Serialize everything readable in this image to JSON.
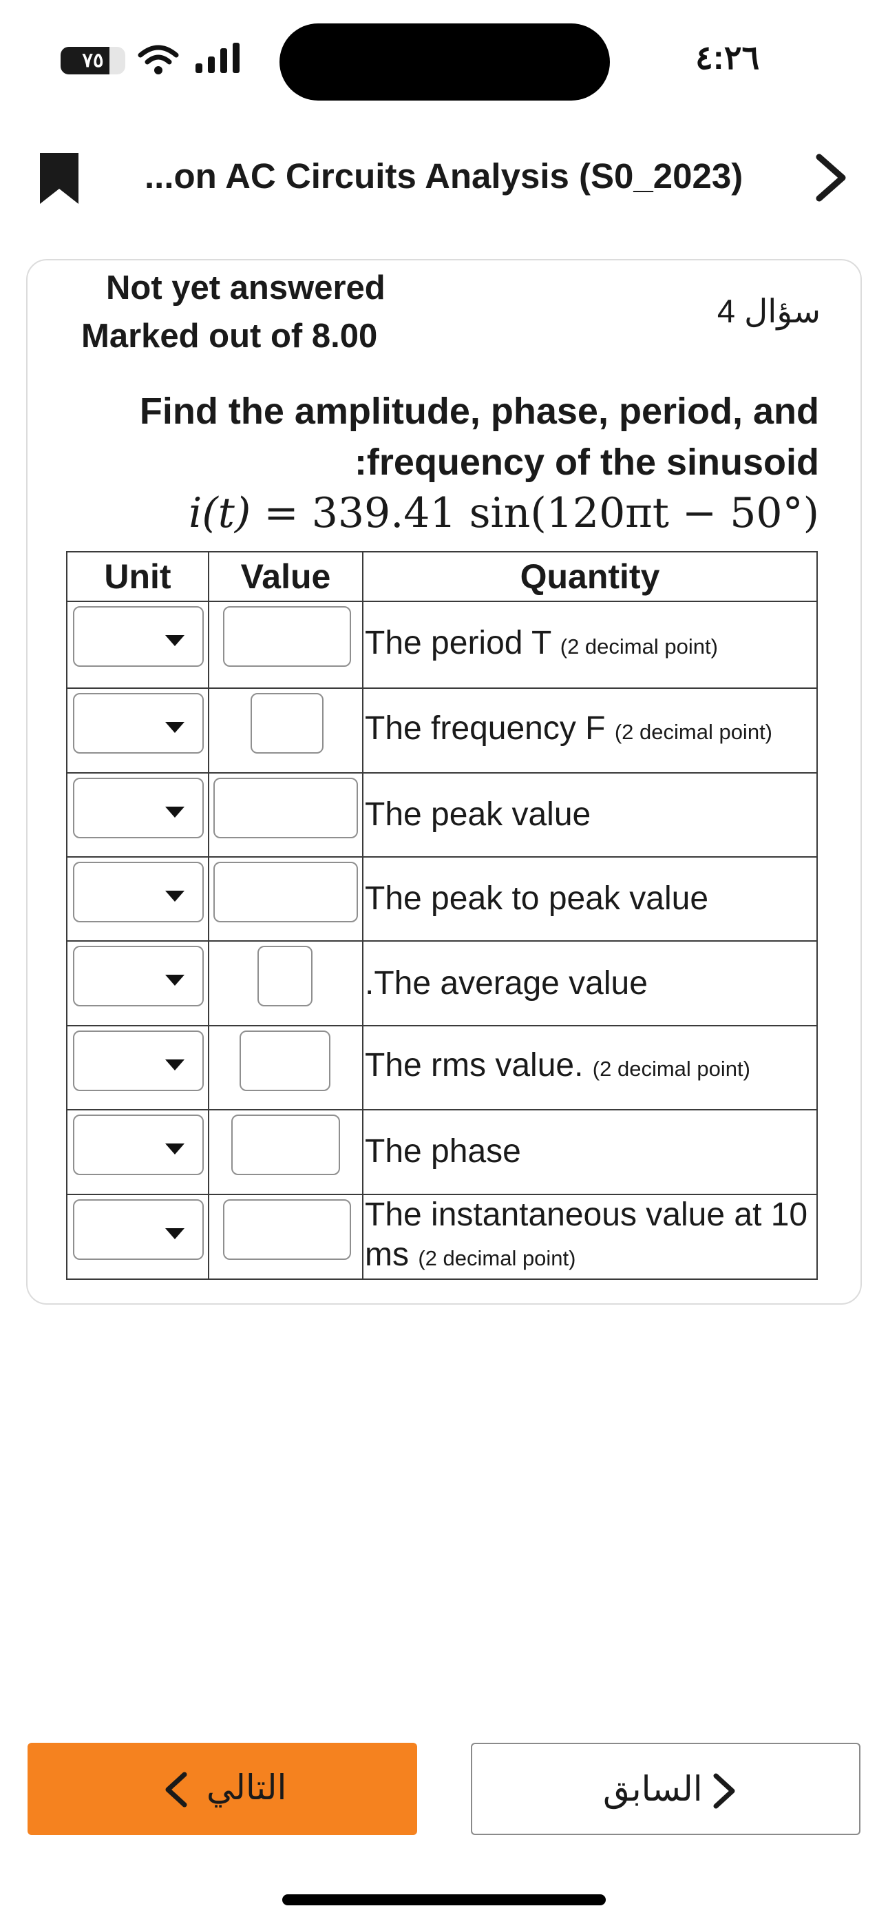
{
  "status_bar": {
    "battery_level": "٧٥",
    "battery_fraction": 0.75,
    "time": "٤:٢٦"
  },
  "nav": {
    "title": "...on AC Circuits Analysis (S0_2023)"
  },
  "question": {
    "number_label": "سؤال 4",
    "state": "Not yet answered",
    "mark": "Marked out of 8.00",
    "prompt_line1": "Find the amplitude, phase, period, and",
    "prompt_line2": ":frequency of the sinusoid",
    "formula": {
      "lhs": "i(t)",
      "equals": "=",
      "rhs": "339.41 sin(120πt − 50°)"
    }
  },
  "table": {
    "headers": {
      "unit": "Unit",
      "value": "Value",
      "quantity": "Quantity"
    },
    "rows": [
      {
        "quantity": "The period T",
        "note": "(2 decimal point)"
      },
      {
        "quantity": "The frequency F",
        "note": "(2 decimal point)"
      },
      {
        "quantity": "The peak value",
        "note": ""
      },
      {
        "quantity": "The peak to peak value",
        "note": ""
      },
      {
        "quantity": ".The average value",
        "note": ""
      },
      {
        "quantity": "The rms value.",
        "note": "(2 decimal point)"
      },
      {
        "quantity": "The phase",
        "note": ""
      },
      {
        "quantity": "The instantaneous value at 10 ms",
        "note": "(2 decimal point)"
      }
    ]
  },
  "buttons": {
    "next": "التالي",
    "previous": "السابق"
  },
  "colors": {
    "accent": "#f5821f",
    "border": "#3a3a3a",
    "text": "#1a1a1a"
  }
}
